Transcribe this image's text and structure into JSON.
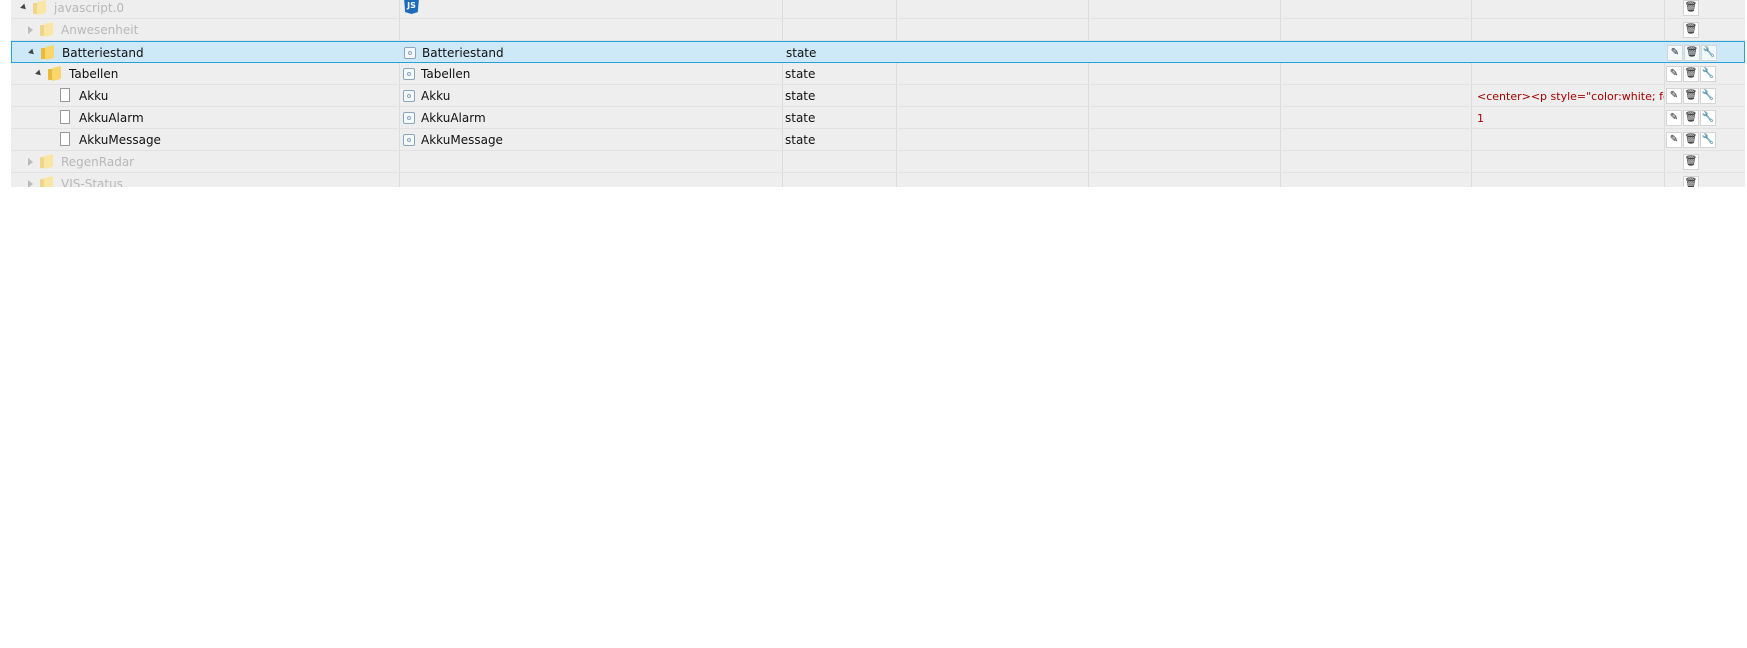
{
  "rows": [
    {
      "id": "javascript.0",
      "name": "",
      "type": "",
      "value": "",
      "actions": [
        "delete"
      ],
      "icon": "js-icon"
    },
    {
      "id": "Anwesenheit",
      "name": "",
      "type": "",
      "value": "",
      "actions": [
        "delete"
      ]
    },
    {
      "id": "Batteriestand",
      "name": "Batteriestand",
      "type": "state",
      "value": "",
      "actions": [
        "edit",
        "delete",
        "wrench"
      ]
    },
    {
      "id": "Tabellen",
      "name": "Tabellen",
      "type": "state",
      "value": "",
      "actions": [
        "edit",
        "delete",
        "wrench"
      ]
    },
    {
      "id": "Akku",
      "name": "Akku",
      "type": "state",
      "value": "<center><p style=\"color:white; fon",
      "actions": [
        "edit",
        "delete",
        "wrench"
      ]
    },
    {
      "id": "AkkuAlarm",
      "name": "AkkuAlarm",
      "type": "state",
      "value": "1",
      "actions": [
        "edit",
        "delete",
        "wrench"
      ]
    },
    {
      "id": "AkkuMessage",
      "name": "AkkuMessage",
      "type": "state",
      "value": "",
      "actions": [
        "edit",
        "delete",
        "wrench"
      ]
    },
    {
      "id": "RegenRadar",
      "name": "",
      "type": "",
      "value": "",
      "actions": [
        "delete"
      ]
    },
    {
      "id": "VIS-Status",
      "name": "",
      "type": "",
      "value": "",
      "actions": [
        "delete"
      ]
    }
  ],
  "icons": {
    "edit": "pencil-icon",
    "delete": "trash-icon",
    "wrench": "wrench-icon",
    "folder": "folder-icon",
    "file": "file-icon"
  },
  "colors": {
    "selected_bg": "#cde8f6",
    "selected_border": "#26a0da",
    "value_text": "#a40000"
  }
}
